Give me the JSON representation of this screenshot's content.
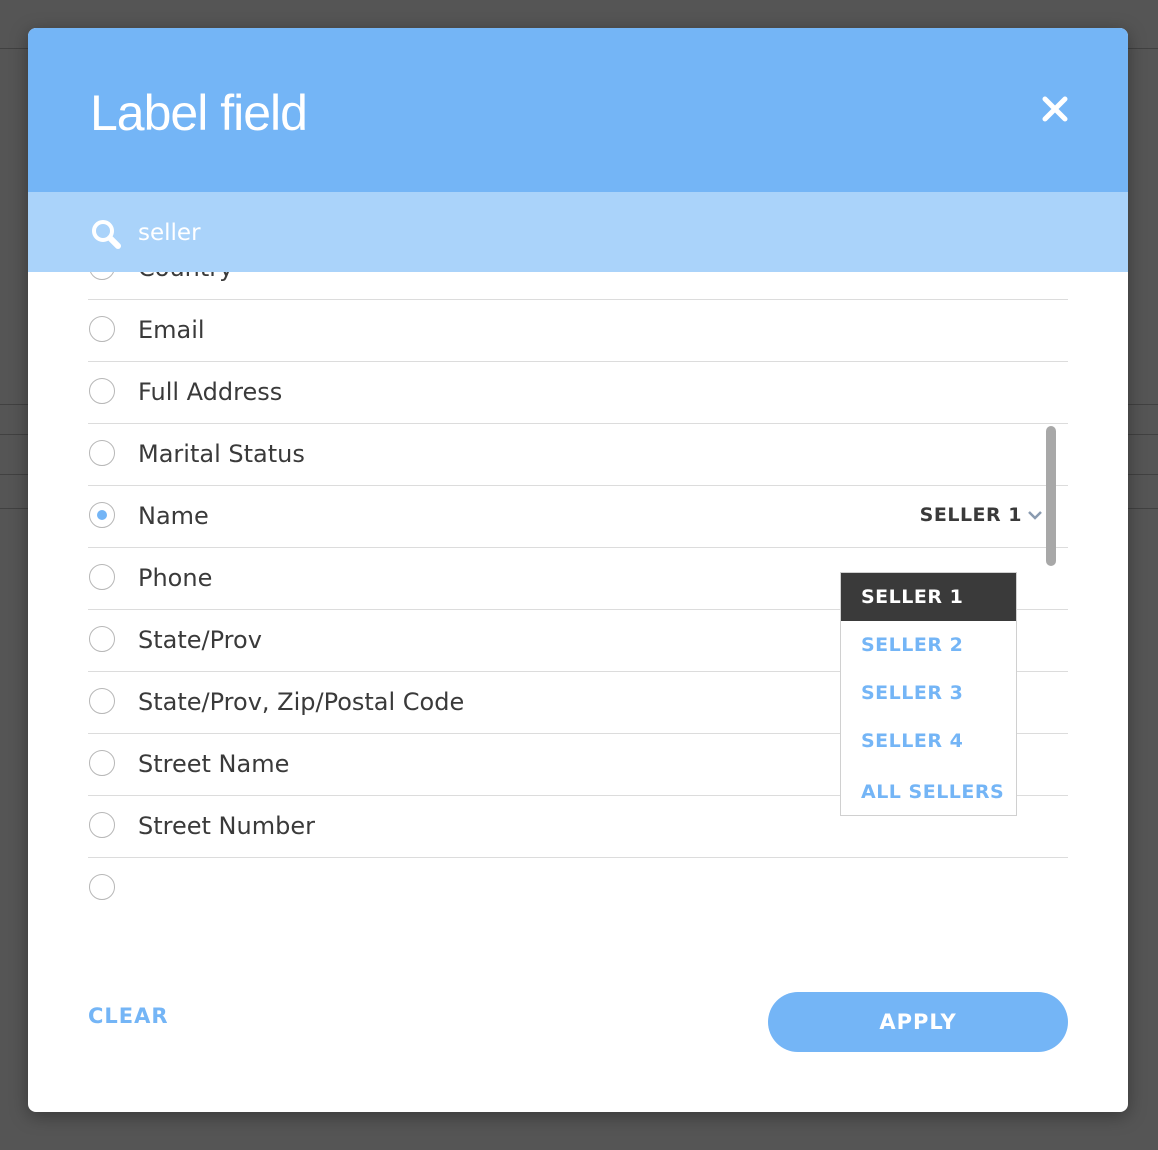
{
  "dialog": {
    "title": "Label field",
    "search": {
      "value": "seller",
      "placeholder": ""
    },
    "fields": [
      {
        "label": "Country",
        "selected": false
      },
      {
        "label": "Email",
        "selected": false
      },
      {
        "label": "Full Address",
        "selected": false
      },
      {
        "label": "Marital Status",
        "selected": false
      },
      {
        "label": "Name",
        "selected": true,
        "seller_value": "SELLER 1"
      },
      {
        "label": "Phone",
        "selected": false
      },
      {
        "label": "State/Prov",
        "selected": false
      },
      {
        "label": "State/Prov, Zip/Postal Code",
        "selected": false
      },
      {
        "label": "Street Name",
        "selected": false
      },
      {
        "label": "Street Number",
        "selected": false
      },
      {
        "label": "",
        "selected": false
      }
    ],
    "seller_dropdown": {
      "options": [
        "SELLER 1",
        "SELLER 2",
        "SELLER 3",
        "SELLER 4",
        "ALL SELLERS"
      ],
      "selected": "SELLER 1"
    },
    "clear_label": "CLEAR",
    "apply_label": "APPLY"
  },
  "colors": {
    "accent": "#74b5f6",
    "search_bar": "#aad3fa",
    "dropdown_selected_bg": "#3a3a3a"
  },
  "icons": {
    "close": "close-icon",
    "search": "search-icon",
    "dropdown": "chevron-down-icon"
  }
}
